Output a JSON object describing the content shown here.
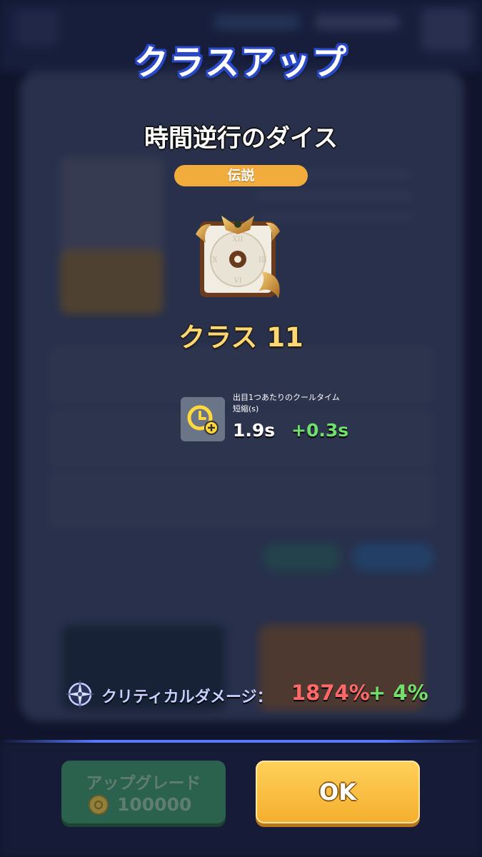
{
  "dialog": {
    "title": "クラスアップ",
    "item_name": "時間逆行のダイス",
    "rarity": "伝説",
    "class_label": "クラス 11"
  },
  "stat": {
    "description_line1": "出目1つあたりのクールタイム",
    "description_line2": "短縮(s)",
    "value": "1.9s",
    "bonus": "+0.3s"
  },
  "critical": {
    "label": "クリティカルダメージ：",
    "value": "1874%",
    "bonus": "+ 4%"
  },
  "buttons": {
    "upgrade_label": "アップグレード",
    "upgrade_cost": "100000",
    "ok_label": "OK"
  },
  "icons": {
    "dice": "clock-dice-icon",
    "stat": "cooldown-clock-plus-icon",
    "critical": "crosshair-compass-icon",
    "coin": "coin-icon"
  },
  "colors": {
    "rarity_badge": "#f2ac3c",
    "class_text": "#ffd873",
    "crit_value": "#ff6868",
    "bonus_green": "#72e06b",
    "ok_button": "#f4ae2e",
    "upgrade_button": "#2f6f52"
  }
}
